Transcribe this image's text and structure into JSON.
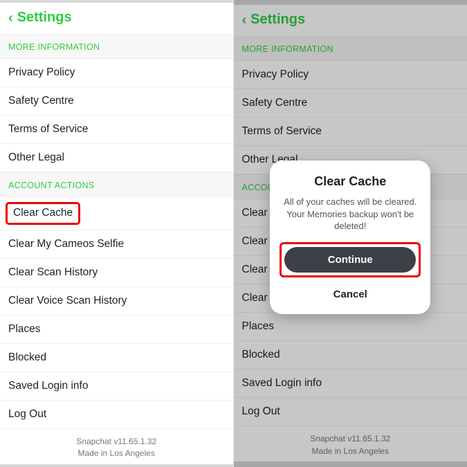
{
  "nav": {
    "back_glyph": "‹",
    "title": "Settings"
  },
  "sections": {
    "more_info_header": "MORE INFORMATION",
    "account_actions_header": "ACCOUNT ACTIONS"
  },
  "rows": {
    "privacy_policy": "Privacy Policy",
    "safety_centre": "Safety Centre",
    "terms_of_service": "Terms of Service",
    "other_legal": "Other Legal",
    "clear_cache": "Clear Cache",
    "clear_cameos": "Clear My Cameos Selfie",
    "clear_scan_history": "Clear Scan History",
    "clear_voice_scan_history": "Clear Voice Scan History",
    "places": "Places",
    "blocked": "Blocked",
    "saved_login_info": "Saved Login info",
    "log_out": "Log Out"
  },
  "footer": {
    "version": "Snapchat v11.65.1.32",
    "made_in": "Made in Los Angeles"
  },
  "dialog": {
    "title": "Clear Cache",
    "body": "All of your caches will be cleared. Your Memories backup won't be deleted!",
    "continue": "Continue",
    "cancel": "Cancel"
  }
}
